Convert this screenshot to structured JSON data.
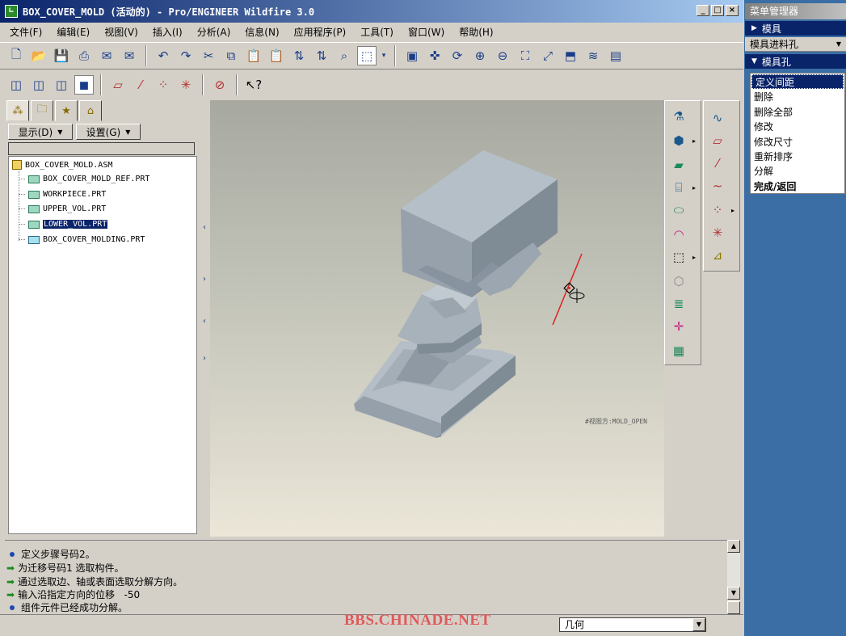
{
  "window": {
    "title": "BOX_COVER_MOLD (活动的) - Pro/ENGINEER Wildfire 3.0",
    "controls": [
      "_",
      "□",
      "×"
    ]
  },
  "menubar": [
    "文件(F)",
    "编辑(E)",
    "视图(V)",
    "插入(I)",
    "分析(A)",
    "信息(N)",
    "应用程序(P)",
    "工具(T)",
    "窗口(W)",
    "帮助(H)"
  ],
  "navigator": {
    "show_label": "显示(D)",
    "settings_label": "设置(G)",
    "tree": [
      {
        "label": "BOX_COVER_MOLD.ASM",
        "level": 0,
        "selected": false
      },
      {
        "label": "BOX_COVER_MOLD_REF.PRT",
        "level": 1,
        "selected": false
      },
      {
        "label": "WORKPIECE.PRT",
        "level": 1,
        "selected": false
      },
      {
        "label": "UPPER_VOL.PRT",
        "level": 1,
        "selected": false
      },
      {
        "label": "LOWER_VOL.PRT",
        "level": 1,
        "selected": true
      },
      {
        "label": "BOX_COVER_MOLDING.PRT",
        "level": 1,
        "selected": false
      }
    ]
  },
  "viewport": {
    "view_name": "#视图方:MOLD_OPEN"
  },
  "menu_manager": {
    "title": "菜单管理器",
    "header_mold": "模具",
    "row_mold_advance": "模具进料孔",
    "header_mold_hole": "模具孔",
    "items": [
      "定义间距",
      "删除",
      "删除全部",
      "修改",
      "修改尺寸",
      "重新排序",
      "分解",
      "完成/返回"
    ],
    "highlighted_index": 0
  },
  "messages": [
    {
      "type": "info",
      "text": "定义步骤号码2。"
    },
    {
      "type": "prompt",
      "text": "为迁移号码1 选取构件。"
    },
    {
      "type": "prompt",
      "text": "通过选取边、轴或表面选取分解方向。"
    },
    {
      "type": "prompt",
      "text": "输入沿指定方向的位移   -50"
    },
    {
      "type": "info",
      "text": "组件元件已经成功分解。"
    }
  ],
  "status": {
    "watermark": "BBS.CHINADE.NET",
    "filter_value": "几何"
  },
  "colors": {
    "titlebar_start": "#0a246a",
    "titlebar_end": "#a6caf0",
    "desktop_blue": "#3b6ea5",
    "selection": "#0a246a",
    "model_gray": "#a9b3bb",
    "axis_red": "#e02020"
  }
}
